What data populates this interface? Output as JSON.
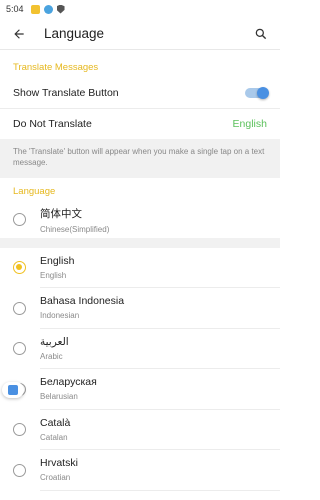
{
  "status_bar": {
    "time": "5:04"
  },
  "app_bar": {
    "title": "Language"
  },
  "translate_section": {
    "header": "Translate Messages",
    "show_button_label": "Show Translate Button",
    "show_button_on": true,
    "do_not_translate_label": "Do Not Translate",
    "do_not_translate_value": "English",
    "info": "The 'Translate' button will appear when you make a single tap on a text message."
  },
  "language_section": {
    "header": "Language",
    "pinned": {
      "name": "简体中文",
      "sub": "Chinese(Simplified)",
      "selected": false
    },
    "items": [
      {
        "name": "English",
        "sub": "English",
        "selected": true
      },
      {
        "name": "Bahasa Indonesia",
        "sub": "Indonesian",
        "selected": false
      },
      {
        "name": "العربية",
        "sub": "Arabic",
        "selected": false
      },
      {
        "name": "Беларуская",
        "sub": "Belarusian",
        "selected": false
      },
      {
        "name": "Català",
        "sub": "Catalan",
        "selected": false
      },
      {
        "name": "Hrvatski",
        "sub": "Croatian",
        "selected": false
      }
    ]
  },
  "colors": {
    "accent_yellow": "#e6b81e",
    "value_green": "#5cc15c",
    "toggle_blue": "#4a90e2"
  }
}
